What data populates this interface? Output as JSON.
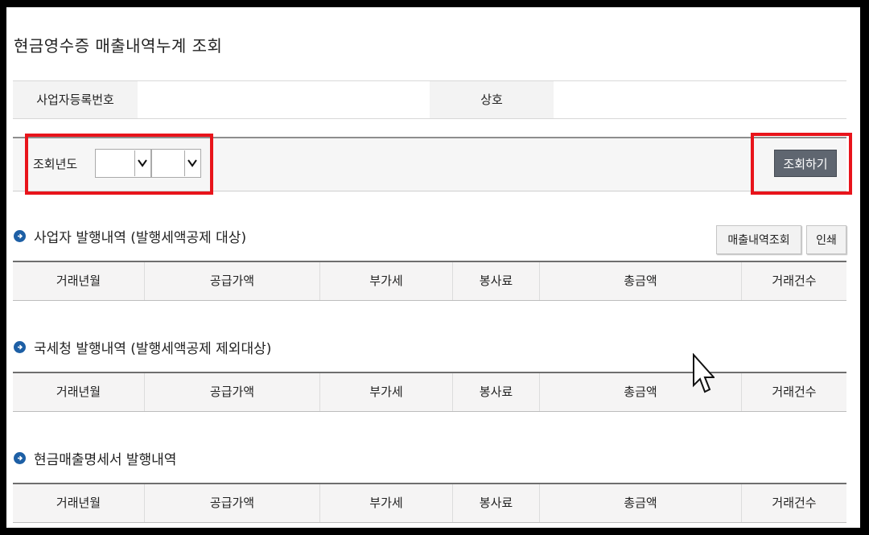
{
  "page": {
    "title": "현금영수증 매출내역누계 조회"
  },
  "business_info": {
    "reg_no_label": "사업자등록번호",
    "reg_no_value": "",
    "name_label": "상호",
    "name_value": ""
  },
  "search": {
    "year_label": "조회년도",
    "select1_value": "",
    "select2_value": "",
    "button_label": "조회하기"
  },
  "sections": [
    {
      "title": "사업자 발행내역 (발행세액공제 대상)",
      "buttons": [
        "매출내역조회",
        "인쇄"
      ],
      "columns": [
        "거래년월",
        "공급가액",
        "부가세",
        "봉사료",
        "총금액",
        "거래건수"
      ]
    },
    {
      "title": "국세청 발행내역 (발행세액공제 제외대상)",
      "columns": [
        "거래년월",
        "공급가액",
        "부가세",
        "봉사료",
        "총금액",
        "거래건수"
      ]
    },
    {
      "title": "현금매출명세서 발행내역",
      "columns": [
        "거래년월",
        "공급가액",
        "부가세",
        "봉사료",
        "총금액",
        "거래건수"
      ]
    }
  ],
  "colors": {
    "accent_red": "#e8141b",
    "button_dark": "#5f6670",
    "bullet_blue": "#1d5fa5"
  },
  "icons": [
    "chevron-down-icon",
    "arrow-right-circle-icon",
    "mouse-cursor-icon"
  ]
}
